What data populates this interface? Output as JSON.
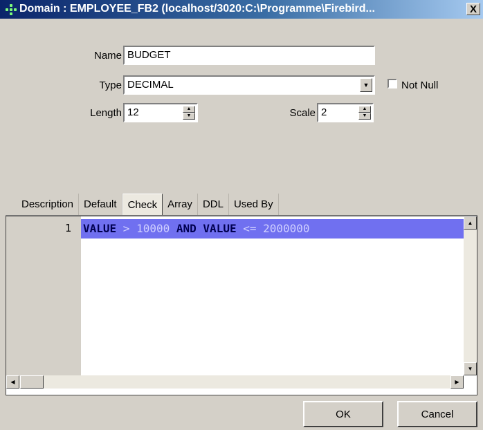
{
  "window": {
    "title": "Domain : EMPLOYEE_FB2 (localhost/3020:C:\\Programme\\Firebird...",
    "close_label": "X"
  },
  "form": {
    "name_label": "Name",
    "name_value": "BUDGET",
    "type_label": "Type",
    "type_value": "DECIMAL",
    "not_null_label": "Not Null",
    "not_null_checked": false,
    "length_label": "Length",
    "length_value": "12",
    "scale_label": "Scale",
    "scale_value": "2"
  },
  "tabs": [
    {
      "label": "Description"
    },
    {
      "label": "Default"
    },
    {
      "label": "Check",
      "active": true
    },
    {
      "label": "Array"
    },
    {
      "label": "DDL"
    },
    {
      "label": "Used By"
    }
  ],
  "editor": {
    "line_number": "1",
    "tokens": [
      {
        "text": "VALUE",
        "kw": true
      },
      {
        "text": " > 10000 ",
        "kw": false
      },
      {
        "text": "AND",
        "kw": true
      },
      {
        "text": " ",
        "kw": false
      },
      {
        "text": "VALUE",
        "kw": true
      },
      {
        "text": " <= 2000000",
        "kw": false
      }
    ],
    "highlight_color": "#7070f0"
  },
  "buttons": {
    "ok_label": "OK",
    "cancel_label": "Cancel"
  },
  "icons": {
    "app": "database-domain-icon",
    "combo": "chevron-down-icon",
    "scroll_up": "arrow-up-icon",
    "scroll_down": "arrow-down-icon",
    "scroll_left": "arrow-left-icon",
    "scroll_right": "arrow-right-icon"
  }
}
